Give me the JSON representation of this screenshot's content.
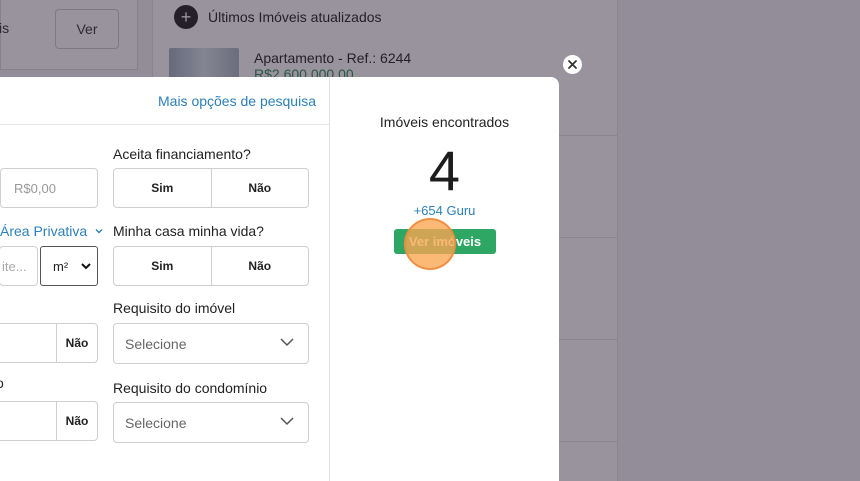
{
  "background": {
    "left_card_text": "is",
    "ver_button": "Ver",
    "section_title": "Últimos Imóveis atualizados",
    "plus_icon": "+",
    "property": {
      "title": "Apartamento - Ref.: 6244",
      "price": "R$2.600.000,00"
    }
  },
  "modal": {
    "more_options_link": "Mais opções de pesquisa",
    "price_input_placeholder": "R$0,00",
    "area_link": "Área Privativa",
    "area_input_placeholder": "ite...",
    "unit_select_value": "m²",
    "left_row3_no": "Não",
    "left_row4_label": "o",
    "left_row4_no": "Não",
    "aceita_financiamento": {
      "label": "Aceita financiamento?",
      "yes": "Sim",
      "no": "Não"
    },
    "minha_casa": {
      "label": "Minha casa minha vida?",
      "yes": "Sim",
      "no": "Não"
    },
    "requisito_imovel": {
      "label": "Requisito do imóvel",
      "placeholder": "Selecione"
    },
    "requisito_condominio": {
      "label": "Requisito do condomínio",
      "placeholder": "Selecione"
    },
    "results": {
      "title": "Imóveis encontrados",
      "count": "4",
      "guru": "+654 Guru",
      "button": "Ver imóveis"
    }
  },
  "colors": {
    "accent_blue": "#2c7fb8",
    "button_green": "#2ea664",
    "click_indicator": "#faa550"
  }
}
